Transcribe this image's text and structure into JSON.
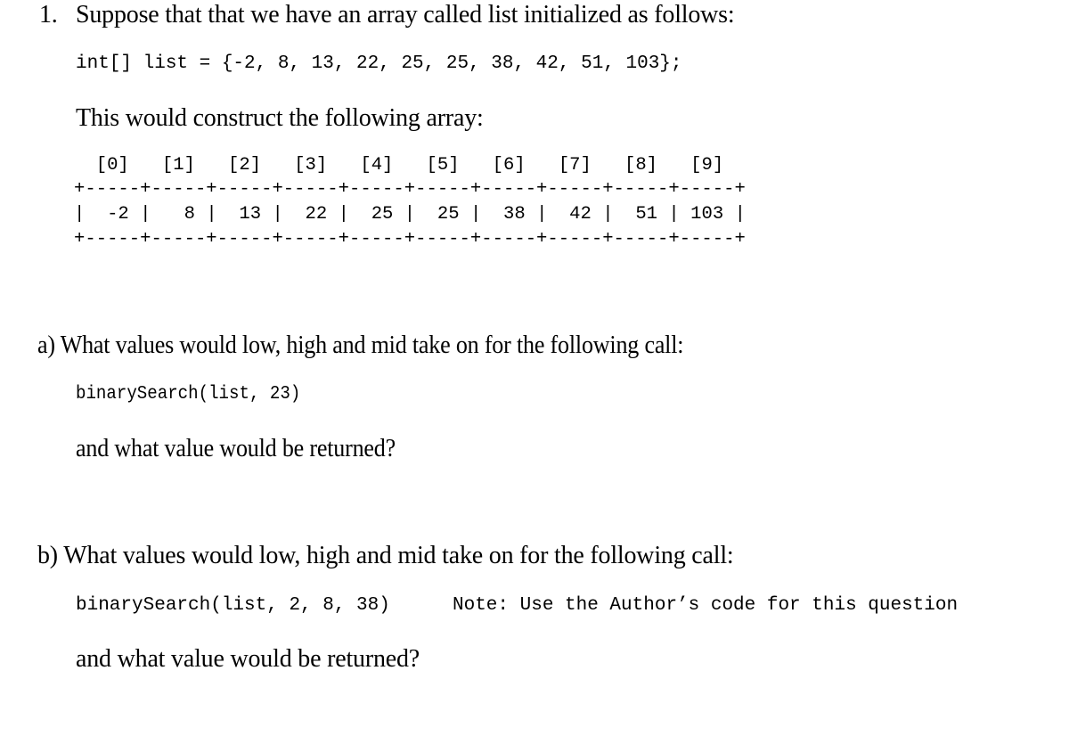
{
  "question": {
    "number": "1.",
    "intro": "Suppose that that we have an array called list initialized as follows:",
    "declaration": "int[] list = {-2, 8, 13, 22, 25, 25, 38, 42, 51, 103};",
    "construct_text": "This would construct the following array:"
  },
  "array_table": {
    "indices": [
      "[0]",
      "[1]",
      "[2]",
      "[3]",
      "[4]",
      "[5]",
      "[6]",
      "[7]",
      "[8]",
      "[9]"
    ],
    "values": [
      "-2",
      "8",
      "13",
      "22",
      "25",
      "25",
      "38",
      "42",
      "51",
      "103"
    ]
  },
  "part_a": {
    "prompt": "a) What values would low, high and mid take on for the following call:",
    "call": "binarySearch(list, 23)",
    "followup": "and what value would be returned?"
  },
  "part_b": {
    "prompt": "b) What values would low, high and mid take on for the following call:",
    "call": "binarySearch(list, 2, 8, 38)",
    "note": "Note: Use the Author’s code for this question",
    "followup": "and what value would be returned?"
  }
}
